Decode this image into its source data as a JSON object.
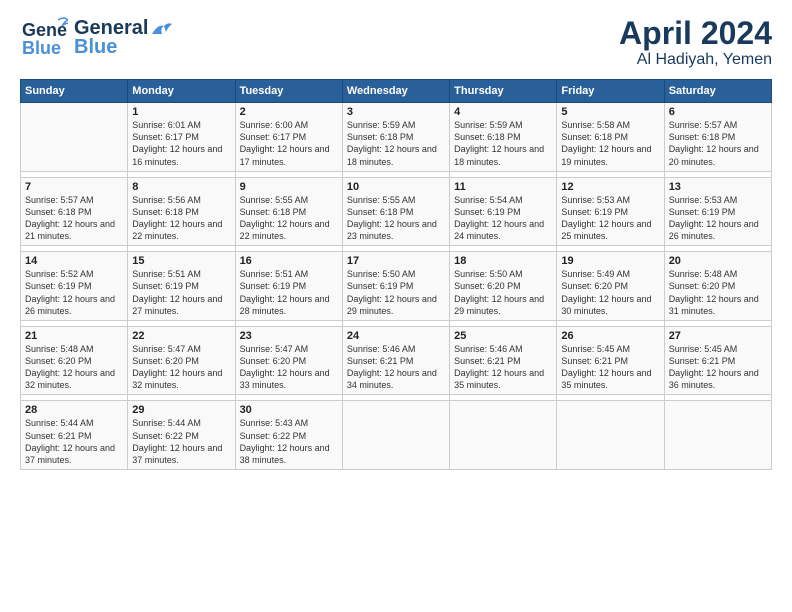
{
  "header": {
    "logo_line1": "General",
    "logo_line2": "Blue",
    "title": "April 2024",
    "subtitle": "Al Hadiyah, Yemen"
  },
  "weekdays": [
    "Sunday",
    "Monday",
    "Tuesday",
    "Wednesday",
    "Thursday",
    "Friday",
    "Saturday"
  ],
  "weeks": [
    [
      {
        "num": "",
        "sunrise": "",
        "sunset": "",
        "daylight": ""
      },
      {
        "num": "1",
        "sunrise": "Sunrise: 6:01 AM",
        "sunset": "Sunset: 6:17 PM",
        "daylight": "Daylight: 12 hours and 16 minutes."
      },
      {
        "num": "2",
        "sunrise": "Sunrise: 6:00 AM",
        "sunset": "Sunset: 6:17 PM",
        "daylight": "Daylight: 12 hours and 17 minutes."
      },
      {
        "num": "3",
        "sunrise": "Sunrise: 5:59 AM",
        "sunset": "Sunset: 6:18 PM",
        "daylight": "Daylight: 12 hours and 18 minutes."
      },
      {
        "num": "4",
        "sunrise": "Sunrise: 5:59 AM",
        "sunset": "Sunset: 6:18 PM",
        "daylight": "Daylight: 12 hours and 18 minutes."
      },
      {
        "num": "5",
        "sunrise": "Sunrise: 5:58 AM",
        "sunset": "Sunset: 6:18 PM",
        "daylight": "Daylight: 12 hours and 19 minutes."
      },
      {
        "num": "6",
        "sunrise": "Sunrise: 5:57 AM",
        "sunset": "Sunset: 6:18 PM",
        "daylight": "Daylight: 12 hours and 20 minutes."
      }
    ],
    [
      {
        "num": "7",
        "sunrise": "Sunrise: 5:57 AM",
        "sunset": "Sunset: 6:18 PM",
        "daylight": "Daylight: 12 hours and 21 minutes."
      },
      {
        "num": "8",
        "sunrise": "Sunrise: 5:56 AM",
        "sunset": "Sunset: 6:18 PM",
        "daylight": "Daylight: 12 hours and 22 minutes."
      },
      {
        "num": "9",
        "sunrise": "Sunrise: 5:55 AM",
        "sunset": "Sunset: 6:18 PM",
        "daylight": "Daylight: 12 hours and 22 minutes."
      },
      {
        "num": "10",
        "sunrise": "Sunrise: 5:55 AM",
        "sunset": "Sunset: 6:18 PM",
        "daylight": "Daylight: 12 hours and 23 minutes."
      },
      {
        "num": "11",
        "sunrise": "Sunrise: 5:54 AM",
        "sunset": "Sunset: 6:19 PM",
        "daylight": "Daylight: 12 hours and 24 minutes."
      },
      {
        "num": "12",
        "sunrise": "Sunrise: 5:53 AM",
        "sunset": "Sunset: 6:19 PM",
        "daylight": "Daylight: 12 hours and 25 minutes."
      },
      {
        "num": "13",
        "sunrise": "Sunrise: 5:53 AM",
        "sunset": "Sunset: 6:19 PM",
        "daylight": "Daylight: 12 hours and 26 minutes."
      }
    ],
    [
      {
        "num": "14",
        "sunrise": "Sunrise: 5:52 AM",
        "sunset": "Sunset: 6:19 PM",
        "daylight": "Daylight: 12 hours and 26 minutes."
      },
      {
        "num": "15",
        "sunrise": "Sunrise: 5:51 AM",
        "sunset": "Sunset: 6:19 PM",
        "daylight": "Daylight: 12 hours and 27 minutes."
      },
      {
        "num": "16",
        "sunrise": "Sunrise: 5:51 AM",
        "sunset": "Sunset: 6:19 PM",
        "daylight": "Daylight: 12 hours and 28 minutes."
      },
      {
        "num": "17",
        "sunrise": "Sunrise: 5:50 AM",
        "sunset": "Sunset: 6:19 PM",
        "daylight": "Daylight: 12 hours and 29 minutes."
      },
      {
        "num": "18",
        "sunrise": "Sunrise: 5:50 AM",
        "sunset": "Sunset: 6:20 PM",
        "daylight": "Daylight: 12 hours and 29 minutes."
      },
      {
        "num": "19",
        "sunrise": "Sunrise: 5:49 AM",
        "sunset": "Sunset: 6:20 PM",
        "daylight": "Daylight: 12 hours and 30 minutes."
      },
      {
        "num": "20",
        "sunrise": "Sunrise: 5:48 AM",
        "sunset": "Sunset: 6:20 PM",
        "daylight": "Daylight: 12 hours and 31 minutes."
      }
    ],
    [
      {
        "num": "21",
        "sunrise": "Sunrise: 5:48 AM",
        "sunset": "Sunset: 6:20 PM",
        "daylight": "Daylight: 12 hours and 32 minutes."
      },
      {
        "num": "22",
        "sunrise": "Sunrise: 5:47 AM",
        "sunset": "Sunset: 6:20 PM",
        "daylight": "Daylight: 12 hours and 32 minutes."
      },
      {
        "num": "23",
        "sunrise": "Sunrise: 5:47 AM",
        "sunset": "Sunset: 6:20 PM",
        "daylight": "Daylight: 12 hours and 33 minutes."
      },
      {
        "num": "24",
        "sunrise": "Sunrise: 5:46 AM",
        "sunset": "Sunset: 6:21 PM",
        "daylight": "Daylight: 12 hours and 34 minutes."
      },
      {
        "num": "25",
        "sunrise": "Sunrise: 5:46 AM",
        "sunset": "Sunset: 6:21 PM",
        "daylight": "Daylight: 12 hours and 35 minutes."
      },
      {
        "num": "26",
        "sunrise": "Sunrise: 5:45 AM",
        "sunset": "Sunset: 6:21 PM",
        "daylight": "Daylight: 12 hours and 35 minutes."
      },
      {
        "num": "27",
        "sunrise": "Sunrise: 5:45 AM",
        "sunset": "Sunset: 6:21 PM",
        "daylight": "Daylight: 12 hours and 36 minutes."
      }
    ],
    [
      {
        "num": "28",
        "sunrise": "Sunrise: 5:44 AM",
        "sunset": "Sunset: 6:21 PM",
        "daylight": "Daylight: 12 hours and 37 minutes."
      },
      {
        "num": "29",
        "sunrise": "Sunrise: 5:44 AM",
        "sunset": "Sunset: 6:22 PM",
        "daylight": "Daylight: 12 hours and 37 minutes."
      },
      {
        "num": "30",
        "sunrise": "Sunrise: 5:43 AM",
        "sunset": "Sunset: 6:22 PM",
        "daylight": "Daylight: 12 hours and 38 minutes."
      },
      {
        "num": "",
        "sunrise": "",
        "sunset": "",
        "daylight": ""
      },
      {
        "num": "",
        "sunrise": "",
        "sunset": "",
        "daylight": ""
      },
      {
        "num": "",
        "sunrise": "",
        "sunset": "",
        "daylight": ""
      },
      {
        "num": "",
        "sunrise": "",
        "sunset": "",
        "daylight": ""
      }
    ]
  ]
}
